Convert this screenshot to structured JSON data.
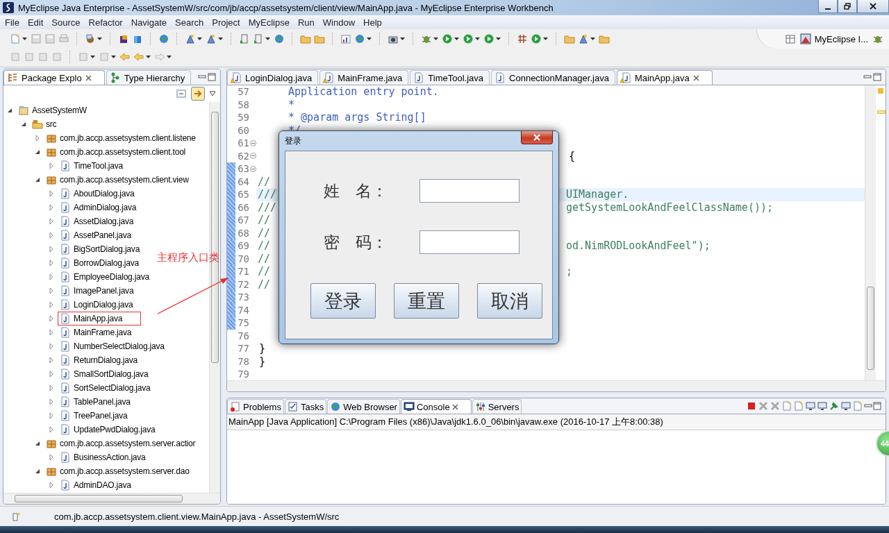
{
  "window": {
    "title": "MyEclipse Java Enterprise - AssetSystemW/src/com/jb/accp/assetsystem/client/view/MainApp.java - MyEclipse Enterprise Workbench"
  },
  "menu": [
    "File",
    "Edit",
    "Source",
    "Refactor",
    "Navigate",
    "Search",
    "Project",
    "MyEclipse",
    "Run",
    "Window",
    "Help"
  ],
  "toolbar": {
    "perspective": "MyEclipse I..."
  },
  "package_explorer": {
    "tabs": [
      {
        "label": "Package Explo",
        "selected": true
      },
      {
        "label": "Type Hierarchy",
        "selected": false
      }
    ],
    "tree": [
      {
        "label": "AssetSystemW",
        "kind": "project",
        "expanded": true,
        "highlighted": false,
        "children": [
          {
            "label": "src",
            "kind": "folder",
            "expanded": true,
            "highlighted": false,
            "children": [
              {
                "label": "com.jb.accp.assetsystem.client.listene",
                "kind": "package",
                "expanded": false,
                "highlighted": false
              },
              {
                "label": "com.jb.accp.assetsystem.client.tool",
                "kind": "package",
                "expanded": true,
                "highlighted": false,
                "children": [
                  {
                    "label": "TimeTool.java",
                    "kind": "file",
                    "expanded": false,
                    "highlighted": false
                  }
                ]
              },
              {
                "label": "com.jb.accp.assetsystem.client.view",
                "kind": "package",
                "expanded": true,
                "highlighted": false,
                "children": [
                  {
                    "label": "AboutDialog.java",
                    "kind": "file",
                    "expanded": false,
                    "highlighted": false
                  },
                  {
                    "label": "AdminDialog.java",
                    "kind": "file",
                    "expanded": false,
                    "highlighted": false
                  },
                  {
                    "label": "AssetDialog.java",
                    "kind": "file",
                    "expanded": false,
                    "highlighted": false
                  },
                  {
                    "label": "AssetPanel.java",
                    "kind": "file",
                    "expanded": false,
                    "highlighted": false
                  },
                  {
                    "label": "BigSortDialog.java",
                    "kind": "file",
                    "expanded": false,
                    "highlighted": false
                  },
                  {
                    "label": "BorrowDialog.java",
                    "kind": "file",
                    "expanded": false,
                    "highlighted": false
                  },
                  {
                    "label": "EmployeeDialog.java",
                    "kind": "file",
                    "expanded": false,
                    "highlighted": false
                  },
                  {
                    "label": "ImagePanel.java",
                    "kind": "file",
                    "expanded": false,
                    "highlighted": false
                  },
                  {
                    "label": "LoginDialog.java",
                    "kind": "file",
                    "expanded": false,
                    "highlighted": false
                  },
                  {
                    "label": "MainApp.java",
                    "kind": "file",
                    "expanded": false,
                    "highlighted": true
                  },
                  {
                    "label": "MainFrame.java",
                    "kind": "file",
                    "expanded": false,
                    "highlighted": false
                  },
                  {
                    "label": "NumberSelectDialog.java",
                    "kind": "file",
                    "expanded": false,
                    "highlighted": false
                  },
                  {
                    "label": "ReturnDialog.java",
                    "kind": "file",
                    "expanded": false,
                    "highlighted": false
                  },
                  {
                    "label": "SmallSortDialog.java",
                    "kind": "file",
                    "expanded": false,
                    "highlighted": false
                  },
                  {
                    "label": "SortSelectDialog.java",
                    "kind": "file",
                    "expanded": false,
                    "highlighted": false
                  },
                  {
                    "label": "TablePanel.java",
                    "kind": "file",
                    "expanded": false,
                    "highlighted": false
                  },
                  {
                    "label": "TreePanel.java",
                    "kind": "file",
                    "expanded": false,
                    "highlighted": false
                  },
                  {
                    "label": "UpdatePwdDialog.java",
                    "kind": "file",
                    "expanded": false,
                    "highlighted": false
                  }
                ]
              },
              {
                "label": "com.jb.accp.assetsystem.server.actior",
                "kind": "package",
                "expanded": true,
                "highlighted": false,
                "children": [
                  {
                    "label": "BusinessAction.java",
                    "kind": "file",
                    "expanded": false,
                    "highlighted": false
                  }
                ]
              },
              {
                "label": "com.jb.accp.assetsystem.server.dao",
                "kind": "package",
                "expanded": true,
                "highlighted": false,
                "children": [
                  {
                    "label": "AdminDAO.java",
                    "kind": "file",
                    "expanded": false,
                    "highlighted": false
                  }
                ]
              }
            ]
          }
        ]
      }
    ]
  },
  "editor": {
    "tabs": [
      {
        "label": "LoginDialog.java",
        "selected": false,
        "warning": true
      },
      {
        "label": "MainFrame.java",
        "selected": false,
        "warning": true
      },
      {
        "label": "TimeTool.java",
        "selected": false,
        "warning": false
      },
      {
        "label": "ConnectionManager.java",
        "selected": false,
        "warning": false
      },
      {
        "label": "MainApp.java",
        "selected": true,
        "warning": true
      }
    ],
    "lines": [
      {
        "number": "57",
        "kind": "javadoc",
        "text": "Application entry point.",
        "fold_marker": false,
        "in_range": false,
        "current": false
      },
      {
        "number": "58",
        "kind": "javadoc",
        "text": "*",
        "fold_marker": false,
        "in_range": false,
        "current": false
      },
      {
        "number": "59",
        "kind": "javadoc",
        "text": "* @param args String[]",
        "fold_marker": false,
        "in_range": false,
        "current": false
      },
      {
        "number": "60",
        "kind": "javadoc",
        "text": "*/",
        "fold_marker": false,
        "in_range": false,
        "current": false
      },
      {
        "number": "61",
        "kind": "code",
        "fold_marker": true,
        "in_range": false,
        "current": false
      },
      {
        "number": "62",
        "kind": "code",
        "right": "{",
        "fold_marker": true,
        "in_range": false,
        "current": false
      },
      {
        "number": "63",
        "kind": "code",
        "fold_marker": true,
        "in_range": true,
        "current": false
      },
      {
        "number": "64",
        "kind": "comment",
        "text": "//",
        "fold_marker": false,
        "in_range": true,
        "current": false
      },
      {
        "number": "65",
        "kind": "comment",
        "text": "///",
        "right": "UIManager.",
        "fold_marker": false,
        "in_range": true,
        "current": true
      },
      {
        "number": "66",
        "kind": "comment",
        "text": "///",
        "right": "getSystemLookAndFeelClassName());",
        "fold_marker": false,
        "in_range": true,
        "current": false
      },
      {
        "number": "67",
        "kind": "comment",
        "text": "//",
        "fold_marker": false,
        "in_range": true,
        "current": false
      },
      {
        "number": "68",
        "kind": "comment",
        "text": "//",
        "fold_marker": false,
        "in_range": true,
        "current": false
      },
      {
        "number": "69",
        "kind": "comment",
        "text": "//",
        "right": "od.NimRODLookAndFeel\");",
        "fold_marker": false,
        "in_range": true,
        "current": false
      },
      {
        "number": "70",
        "kind": "comment",
        "text": "//",
        "fold_marker": false,
        "in_range": true,
        "current": false
      },
      {
        "number": "71",
        "kind": "comment",
        "text": "//",
        "right": ";",
        "fold_marker": false,
        "in_range": true,
        "current": false
      },
      {
        "number": "72",
        "kind": "comment",
        "text": "//",
        "fold_marker": false,
        "in_range": true,
        "current": false
      },
      {
        "number": "73",
        "kind": "code",
        "fold_marker": false,
        "in_range": true,
        "current": false
      },
      {
        "number": "74",
        "kind": "code",
        "fold_marker": false,
        "in_range": true,
        "current": false
      },
      {
        "number": "75",
        "kind": "code",
        "fold_marker": false,
        "in_range": true,
        "current": false
      },
      {
        "number": "76",
        "kind": "code",
        "fold_marker": false,
        "in_range": false,
        "current": false
      },
      {
        "number": "77",
        "kind": "code",
        "text": "}",
        "fold_marker": false,
        "in_range": false,
        "current": false
      },
      {
        "number": "78",
        "kind": "code",
        "text": "}",
        "fold_marker": false,
        "in_range": false,
        "current": false
      },
      {
        "number": "79",
        "kind": "code",
        "fold_marker": false,
        "in_range": false,
        "current": false
      }
    ]
  },
  "login_dialog": {
    "title": "登录",
    "fields": [
      {
        "label": "姓　名："
      },
      {
        "label": "密　码："
      }
    ],
    "buttons": [
      "登录",
      "重置",
      "取消"
    ]
  },
  "annotation": {
    "text": "主程序入口类"
  },
  "console": {
    "tabs": [
      {
        "label": "Problems",
        "selected": false
      },
      {
        "label": "Tasks",
        "selected": false
      },
      {
        "label": "Web Browser",
        "selected": false
      },
      {
        "label": "Console",
        "selected": true
      },
      {
        "label": "Servers",
        "selected": false
      }
    ],
    "launch_info": "MainApp [Java Application] C:\\Program Files (x86)\\Java\\jdk1.6.0_06\\bin\\javaw.exe (2016-10-17 上午8:00:38)"
  },
  "floating_badge": "44",
  "status_bar": {
    "text": "com.jb.accp.assetsystem.client.view.MainApp.java - AssetSystemW/src"
  }
}
